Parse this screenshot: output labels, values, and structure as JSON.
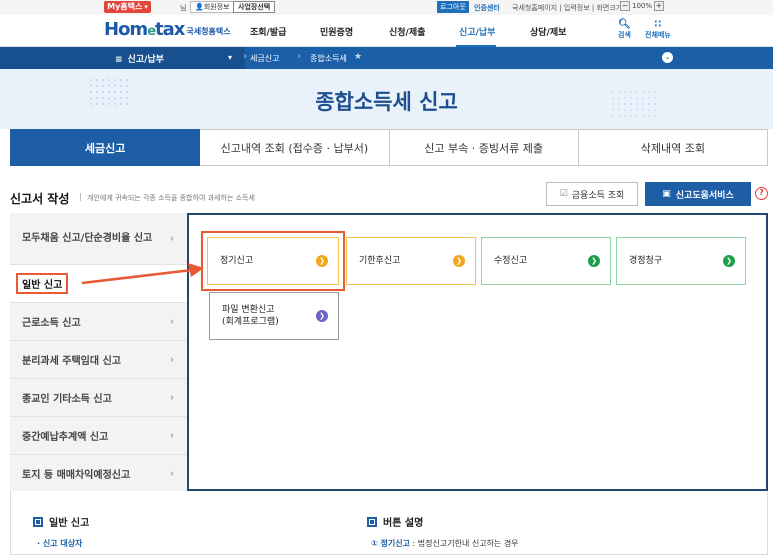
{
  "topbar": {
    "my_hometax": "My홈택스",
    "user_suffix": "님",
    "member_info": "회원정보",
    "business_select": "사업장선택",
    "logout": "로그아웃",
    "cert_center": "인증센터",
    "links": "국세청홈페이지 | 입력정보 | 화면크기",
    "zoom_minus": "−",
    "zoom_value": "100%",
    "zoom_plus": "+"
  },
  "header": {
    "logo_text": "Hom",
    "logo_e": "e",
    "logo_tail": "tax",
    "logo_sub": "국세청홈택스",
    "nav": [
      "조회/발급",
      "민원증명",
      "신청/제출",
      "신고/납부",
      "상담/제보"
    ],
    "active_nav": "신고/납부",
    "search_label": "검색",
    "allmenu_label": "전체메뉴"
  },
  "crumbs": {
    "menu_title": "신고/납부",
    "level1": "세금신고",
    "level2": "종합소득세"
  },
  "page_title": "종합소득세 신고",
  "tabs": [
    "세금신고",
    "신고내역 조회 (접수증 · 납부서)",
    "신고 부속 · 증빙서류 제출",
    "삭제내역 조회"
  ],
  "section": {
    "title": "신고서 작성",
    "desc": "개인에게 귀속되는 각종 소득을 종합하여 과세하는 소득세",
    "btn_finance": "금융소득 조회",
    "btn_help": "신고도움서비스",
    "help_q": "?"
  },
  "leftmenu": [
    "모두채움 신고/단순경비율 신고",
    "일반 신고",
    "근로소득 신고",
    "분리과세 주택임대 신고",
    "종교인 기타소득 신고",
    "중간예납추계액 신고",
    "토지 등 매매차익예정신고"
  ],
  "cards": {
    "regular": "정기신고",
    "late": "기한후신고",
    "amended": "수정신고",
    "claim": "경정청구",
    "file_convert_1": "파일 변환신고",
    "file_convert_2": "(회계프로그램)"
  },
  "bottom": {
    "left_title": "일반 신고",
    "left_item": "· 신고 대상자",
    "right_title": "버튼 설명",
    "right_num": "① 정기신고",
    "right_text": " : 법정신고기한내 신고하는 경우"
  },
  "colors": {
    "brand_blue": "#1d5ea6",
    "highlight_orange": "#e85a33",
    "panel_border": "#24466e"
  }
}
